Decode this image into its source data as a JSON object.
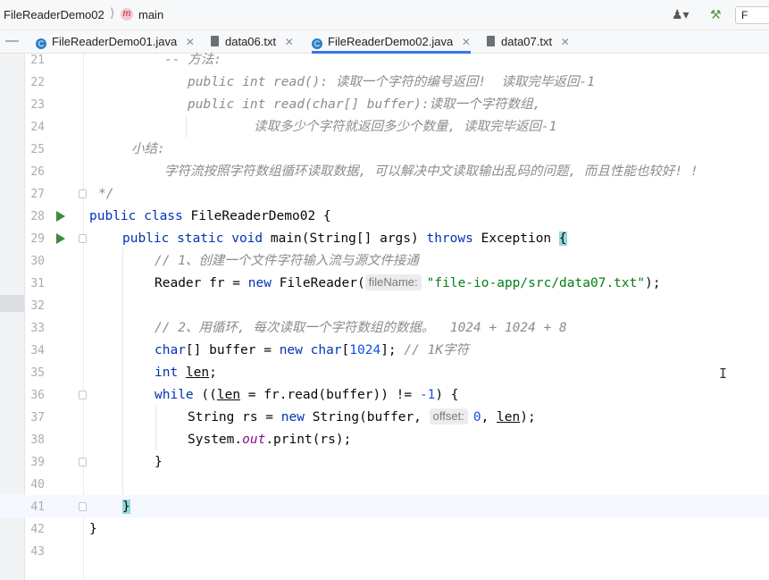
{
  "navbar": {
    "file_crumb": "FileReaderDemo02",
    "separator": "⟩",
    "method_icon": "m",
    "method_crumb": "main",
    "user_icon": "user-icon",
    "build_icon": "hammer-icon",
    "run_config_text": "F"
  },
  "tabs": [
    {
      "label": "FileReaderDemo01.java",
      "icon": "java-class-icon",
      "active": false
    },
    {
      "label": "data06.txt",
      "icon": "text-file-icon",
      "active": false
    },
    {
      "label": "FileReaderDemo02.java",
      "icon": "java-class-icon",
      "active": true
    },
    {
      "label": "data07.txt",
      "icon": "text-file-icon",
      "active": false
    }
  ],
  "tab_close": "✕",
  "collapse_glyph": "—",
  "editor": {
    "line_numbers": [
      "21",
      "22",
      "23",
      "24",
      "25",
      "26",
      "27",
      "28",
      "29",
      "30",
      "31",
      "32",
      "33",
      "34",
      "35",
      "36",
      "37",
      "38",
      "39",
      "40",
      "41",
      "42",
      "43"
    ],
    "code": {
      "l21": "-- 方法:",
      "l22": "public int read(): 读取一个字符的编号返回!  读取完毕返回-1",
      "l23": "public int read(char[] buffer):读取一个字符数组,",
      "l24": "读取多少个字符就返回多少个数量, 读取完毕返回-1",
      "l25": "小结:",
      "l26": "字符流按照字符数组循环读取数据, 可以解决中文读取输出乱码的问题, 而且性能也较好! !",
      "l27": "*/",
      "l28_kw": "public class",
      "l28_rest": " FileReaderDemo02 {",
      "l29_kw": "public static void",
      "l29_mid": " main(String[] args) ",
      "l29_kw2": "throws",
      "l29_rest": " Exception ",
      "l29_brace": "{",
      "l30": "// 1、创建一个文件字符输入流与源文件接通",
      "l31_a": "Reader fr = ",
      "l31_kw": "new",
      "l31_b": " FileReader(",
      "l31_hint": "fileName:",
      "l31_str": "\"file-io-app/src/data07.txt\"",
      "l31_c": ");",
      "l33": "// 2、用循环, 每次读取一个字符数组的数据。  1024 + 1024 + 8",
      "l34_kw": "char",
      "l34_a": "[] buffer = ",
      "l34_kw2": "new",
      "l34_kw3": " char",
      "l34_b": "[",
      "l34_num": "1024",
      "l34_c": "]; ",
      "l34_cmt": "// 1K字符",
      "l35_kw": "int",
      "l35_sp": " ",
      "l35_var": "len",
      "l35_end": ";",
      "l36_kw": "while",
      "l36_a": " ((",
      "l36_var": "len",
      "l36_b": " = fr.read(buffer)) != ",
      "l36_num": "-1",
      "l36_c": ") {",
      "l37_a": "String rs = ",
      "l37_kw": "new",
      "l37_b": " String(buffer, ",
      "l37_hint": "offset:",
      "l37_num": "0",
      "l37_c": ", ",
      "l37_var": "len",
      "l37_d": ");",
      "l38_a": "System.",
      "l38_fld": "out",
      "l38_b": ".print(rs);",
      "l39": "}",
      "l41": "}",
      "l42": "}"
    }
  },
  "mouse_cursor": "I",
  "colors": {
    "keyword": "#0033b3",
    "string": "#067d17",
    "number": "#1750eb",
    "comment": "#8c8c8c",
    "field": "#871094",
    "accent": "#3574f0"
  }
}
